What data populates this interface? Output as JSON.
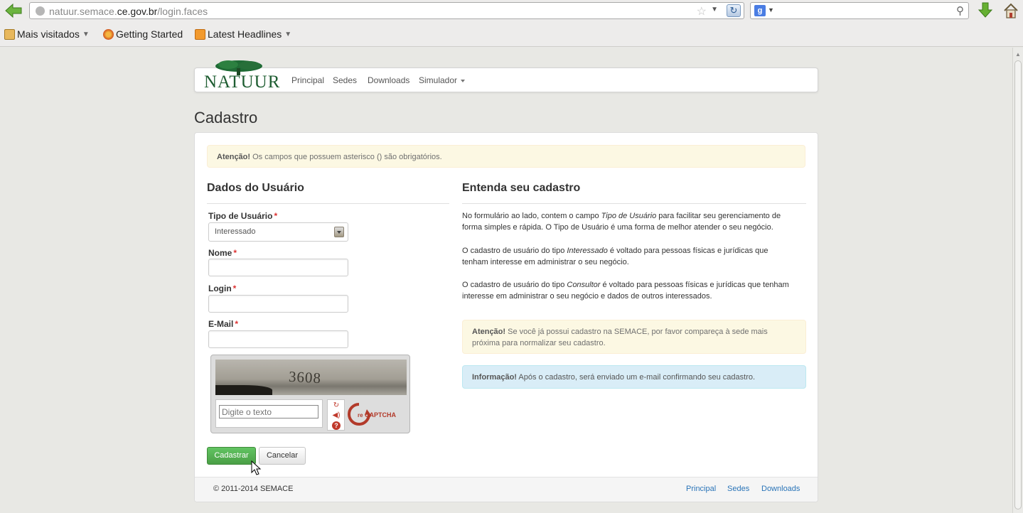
{
  "browser": {
    "url_prefix": "natuur.semace.",
    "url_domain": "ce.gov.br",
    "url_path": "/login.faces",
    "search_engine_letter": "g",
    "bookmarks": [
      {
        "label": "Mais visitados",
        "has_dropdown": true
      },
      {
        "label": "Getting Started",
        "has_dropdown": false
      },
      {
        "label": "Latest Headlines",
        "has_dropdown": true
      }
    ]
  },
  "navbar": {
    "brand": "NATUUR",
    "links": [
      "Principal",
      "Sedes",
      "Downloads",
      "Simulador"
    ]
  },
  "page": {
    "title": "Cadastro",
    "notice_bold": "Atenção!",
    "notice_text": "Os campos que possuem asterisco () são obrigatórios."
  },
  "form": {
    "heading": "Dados do Usuário",
    "tipo_label": "Tipo de Usuário",
    "tipo_value": "Interessado",
    "nome_label": "Nome",
    "login_label": "Login",
    "email_label": "E-Mail",
    "required_mark": "*",
    "captcha_word": "3608",
    "captcha_placeholder": "Digite o texto",
    "submit_label": "Cadastrar",
    "cancel_label": "Cancelar"
  },
  "info": {
    "heading": "Entenda seu cadastro",
    "p1_a": "No formulário ao lado, contem o campo ",
    "p1_em": "Tipo de Usuário",
    "p1_b": " para facilitar seu gerenciamento de forma simples e rápida. O Tipo de Usuário é uma forma de melhor atender o seu negócio.",
    "p2_a": "O cadastro de usuário do tipo ",
    "p2_em": "Interessado",
    "p2_b": " é voltado para pessoas físicas e jurídicas que tenham interesse em administrar o seu negócio.",
    "p3_a": "O cadastro de usuário do tipo ",
    "p3_em": "Consultor",
    "p3_b": " é voltado para pessoas físicas e jurídicas que tenham interesse em administrar o seu negócio e dados de outros interessados.",
    "warn_bold": "Atenção!",
    "warn_text": "Se você já possui cadastro na SEMACE, por favor compareça à sede mais próxima para normalizar seu cadastro.",
    "info_bold": "Informação!",
    "info_text": "Após o cadastro, será enviado um e-mail confirmando seu cadastro."
  },
  "footer": {
    "copyright": "© 2011-2014 SEMACE",
    "links": [
      "Principal",
      "Sedes",
      "Downloads"
    ]
  },
  "colors": {
    "brand_green": "#1e5d31",
    "success": "#5bb75b",
    "link": "#2a74b8",
    "required": "#dd3333"
  }
}
